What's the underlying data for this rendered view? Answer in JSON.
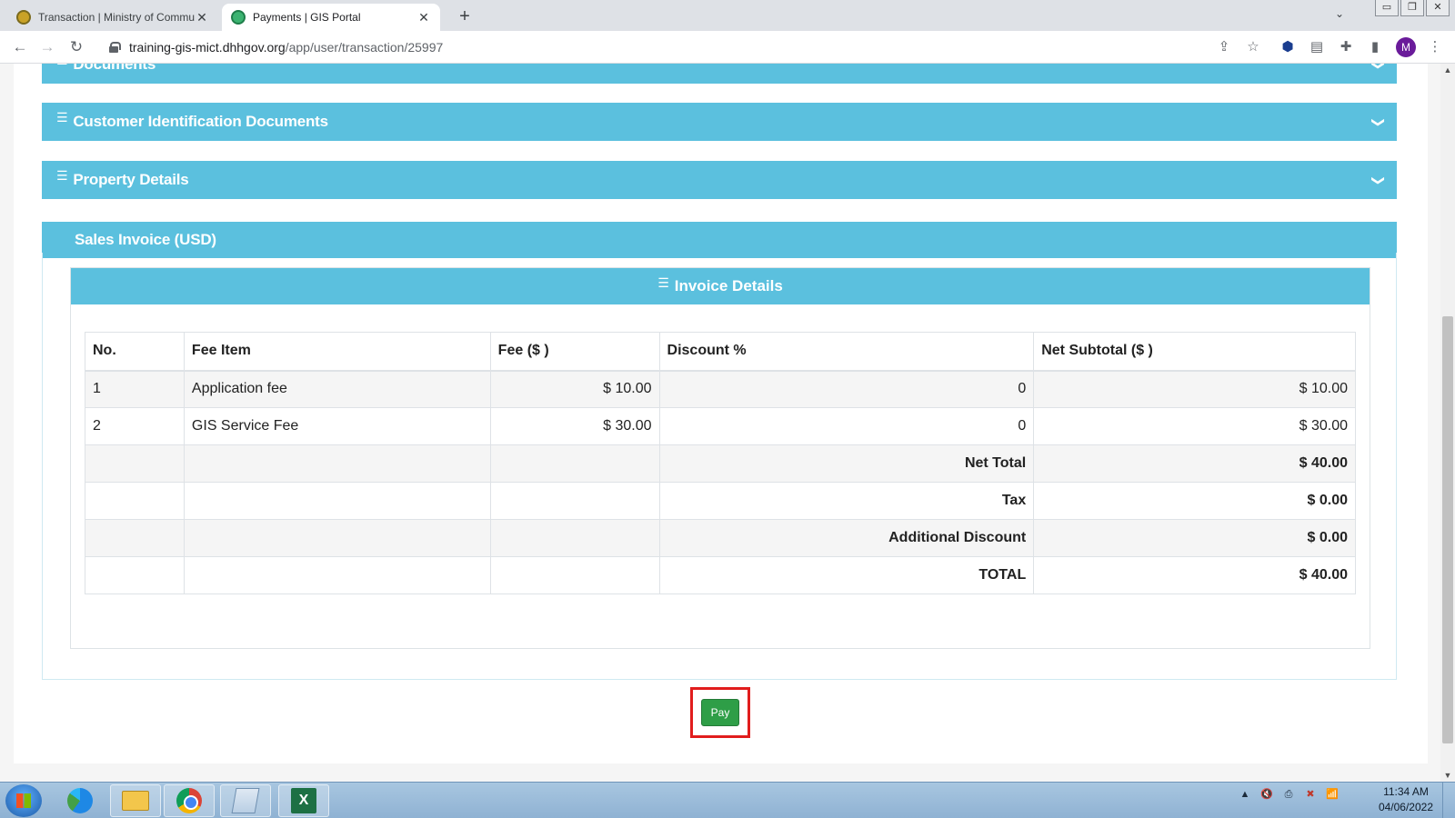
{
  "browser": {
    "tabs": [
      {
        "title": "Transaction | Ministry of Commu",
        "active": false
      },
      {
        "title": "Payments | GIS Portal",
        "active": true
      }
    ],
    "tab_close": "✕",
    "new_tab": "+",
    "tabs_menu": "⌄",
    "url_host": "training-gis-mict.dhhgov.org",
    "url_path": "/app/user/transaction/25997",
    "profile_initial": "M",
    "window_controls": [
      "▭",
      "❐",
      "✕"
    ]
  },
  "page": {
    "sections": [
      {
        "title": "Documents",
        "icon": "list-icon",
        "chevron": "❯"
      },
      {
        "title": "Customer Identification Documents",
        "icon": "list-icon",
        "chevron": "❯"
      },
      {
        "title": "Property Details",
        "icon": "list-icon",
        "chevron": "❯"
      }
    ],
    "invoice_section_title": "Sales Invoice (USD)",
    "invoice_details_title": "Invoice Details",
    "list_glyph": "☰",
    "table": {
      "headers": [
        "No.",
        "Fee Item",
        "Fee ($ )",
        "Discount %",
        "Net Subtotal ($ )"
      ],
      "rows": [
        {
          "no": "1",
          "item": "Application fee",
          "fee": "$ 10.00",
          "discount": "0",
          "subtotal": "$ 10.00"
        },
        {
          "no": "2",
          "item": "GIS Service Fee",
          "fee": "$ 30.00",
          "discount": "0",
          "subtotal": "$ 30.00"
        }
      ],
      "summary": [
        {
          "label": "Net Total",
          "value": "$ 40.00"
        },
        {
          "label": "Tax",
          "value": "$ 0.00"
        },
        {
          "label": "Additional Discount",
          "value": "$ 0.00"
        },
        {
          "label": "TOTAL",
          "value": "$ 40.00"
        }
      ]
    },
    "pay_label": "Pay"
  },
  "taskbar": {
    "apps": [
      "internet-explorer-edge",
      "file-explorer",
      "chrome",
      "notepad",
      "excel"
    ],
    "excel_letter": "X",
    "tray_icons": [
      "▲",
      "🔇",
      "⎙",
      "✖",
      "📶"
    ],
    "time": "11:34 AM",
    "date": "04/06/2022"
  },
  "colors": {
    "panel": "#5bc0de",
    "pay_button": "#2e9e47",
    "highlight": "#e11d1d"
  }
}
